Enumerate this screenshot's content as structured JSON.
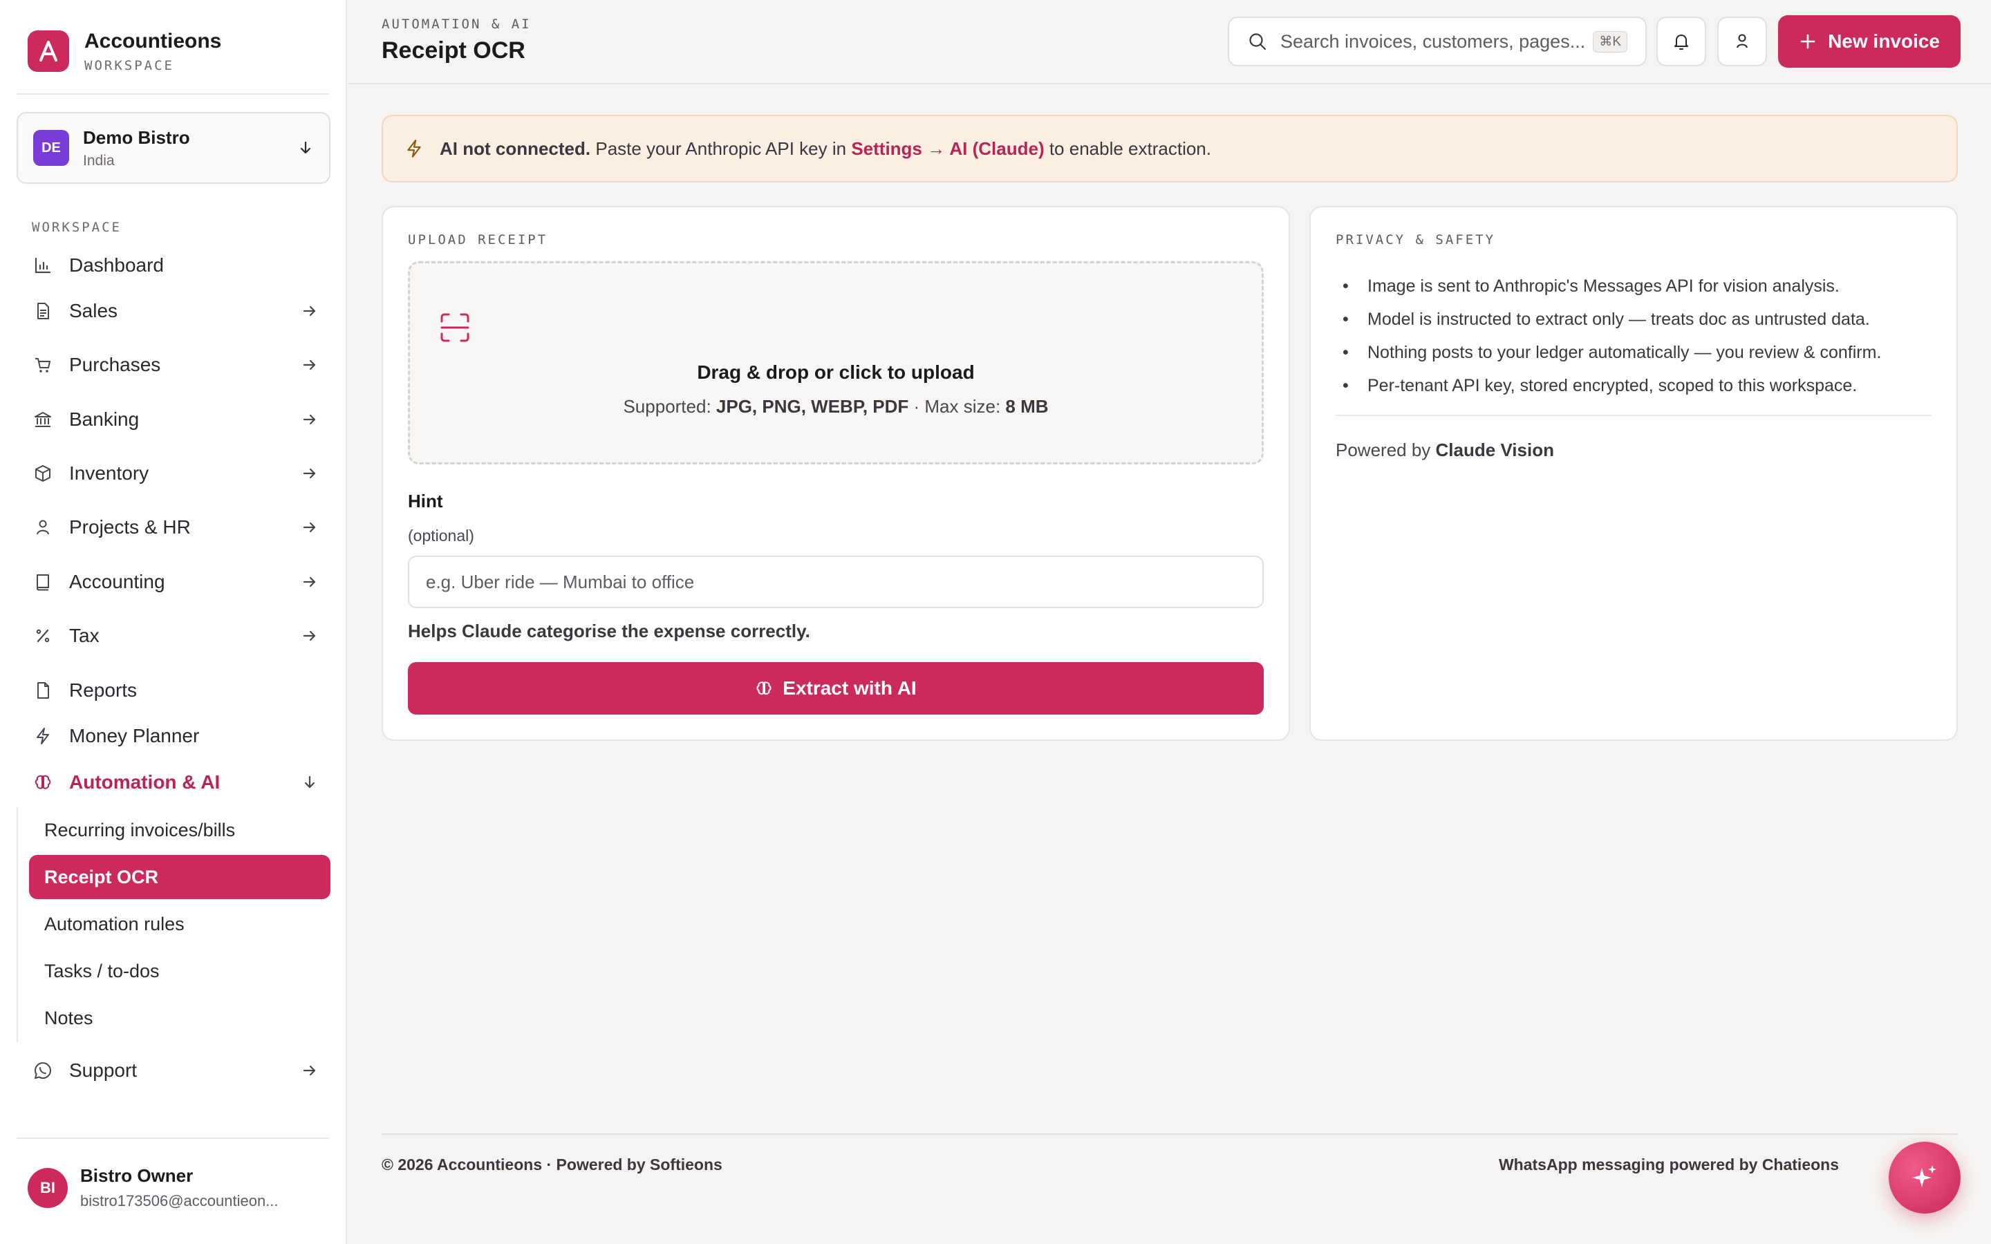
{
  "brand": {
    "name": "Accountieons",
    "sub": "WORKSPACE"
  },
  "org": {
    "initials": "DE",
    "name": "Demo Bistro",
    "country": "India"
  },
  "sidebar": {
    "section_label": "WORKSPACE",
    "items": [
      {
        "label": "Dashboard",
        "icon": "bar-chart-icon",
        "arrow": false
      },
      {
        "label": "Sales",
        "icon": "document-icon",
        "arrow": true
      },
      {
        "label": "Purchases",
        "icon": "cart-icon",
        "arrow": true
      },
      {
        "label": "Banking",
        "icon": "bank-icon",
        "arrow": true
      },
      {
        "label": "Inventory",
        "icon": "box-icon",
        "arrow": true
      },
      {
        "label": "Projects & HR",
        "icon": "person-icon",
        "arrow": true
      },
      {
        "label": "Accounting",
        "icon": "book-icon",
        "arrow": true
      },
      {
        "label": "Tax",
        "icon": "percent-icon",
        "arrow": true
      },
      {
        "label": "Reports",
        "icon": "file-icon",
        "arrow": false
      },
      {
        "label": "Money Planner",
        "icon": "bolt-icon",
        "arrow": false
      },
      {
        "label": "Automation & AI",
        "icon": "brain-icon",
        "arrow": "down"
      }
    ],
    "sub_items": [
      {
        "label": "Recurring invoices/bills",
        "active": false
      },
      {
        "label": "Receipt OCR",
        "active": true
      },
      {
        "label": "Automation rules",
        "active": false
      },
      {
        "label": "Tasks / to-dos",
        "active": false
      },
      {
        "label": "Notes",
        "active": false
      }
    ],
    "support": {
      "label": "Support",
      "icon": "whatsapp-icon"
    }
  },
  "user": {
    "initials": "BI",
    "name": "Bistro Owner",
    "email": "bistro173506@accountieon..."
  },
  "header": {
    "crumb": "AUTOMATION & AI",
    "title": "Receipt OCR",
    "search_placeholder": "Search invoices, customers, pages...",
    "search_shortcut": "⌘K",
    "new_invoice_label": "New invoice"
  },
  "alert": {
    "strong": "AI not connected.",
    "text_before": " Paste your Anthropic API key in ",
    "link": "Settings → AI (Claude)",
    "text_after": " to enable extraction."
  },
  "upload": {
    "label": "UPLOAD RECEIPT",
    "drop_title": "Drag & drop or click to upload",
    "supported_prefix": "Supported: ",
    "supported_formats": "JPG, PNG, WEBP, PDF",
    "max_prefix": " · Max size: ",
    "max_size": "8 MB",
    "hint_label": "Hint",
    "hint_optional": "(optional)",
    "hint_placeholder": "e.g. Uber ride — Mumbai to office",
    "hint_help": "Helps Claude categorise the expense correctly.",
    "extract_label": "Extract with AI"
  },
  "privacy": {
    "label": "PRIVACY & SAFETY",
    "points": [
      "Image is sent to Anthropic's Messages API for vision analysis.",
      "Model is instructed to extract only — treats doc as untrusted data.",
      "Nothing posts to your ledger automatically — you review & confirm.",
      "Per-tenant API key, stored encrypted, scoped to this workspace."
    ],
    "powered_prefix": "Powered by ",
    "powered_name": "Claude Vision"
  },
  "footer": {
    "left_prefix": "© 2026 Accountieons · Powered by ",
    "left_brand": "Softieons",
    "right_prefix": "WhatsApp messaging powered by ",
    "right_brand": "Chatieons"
  },
  "colors": {
    "accent": "#cc2a5c",
    "alert_bg": "#fbefe4",
    "org_avatar": "#7a3bd6"
  }
}
